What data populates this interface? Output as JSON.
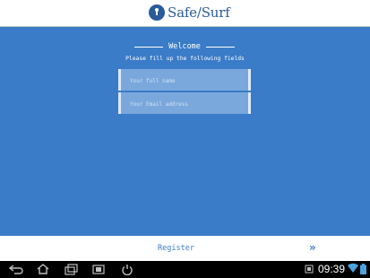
{
  "app": {
    "logo_text": "Safe/Surf"
  },
  "form": {
    "welcome_title": "Welcome",
    "instructions": "Please fill up the following fields",
    "name_placeholder": "Your full name",
    "email_placeholder": "Your Email address"
  },
  "footer": {
    "register_label": "Register",
    "next_icon": "double-chevron-right-icon"
  },
  "status_bar": {
    "time": "09:39"
  },
  "colors": {
    "primary_blue": "#3a7cc8",
    "logo_blue": "#2a5b9a",
    "field_bg": "#7aa8dc",
    "wifi_blue": "#4aa3df"
  }
}
